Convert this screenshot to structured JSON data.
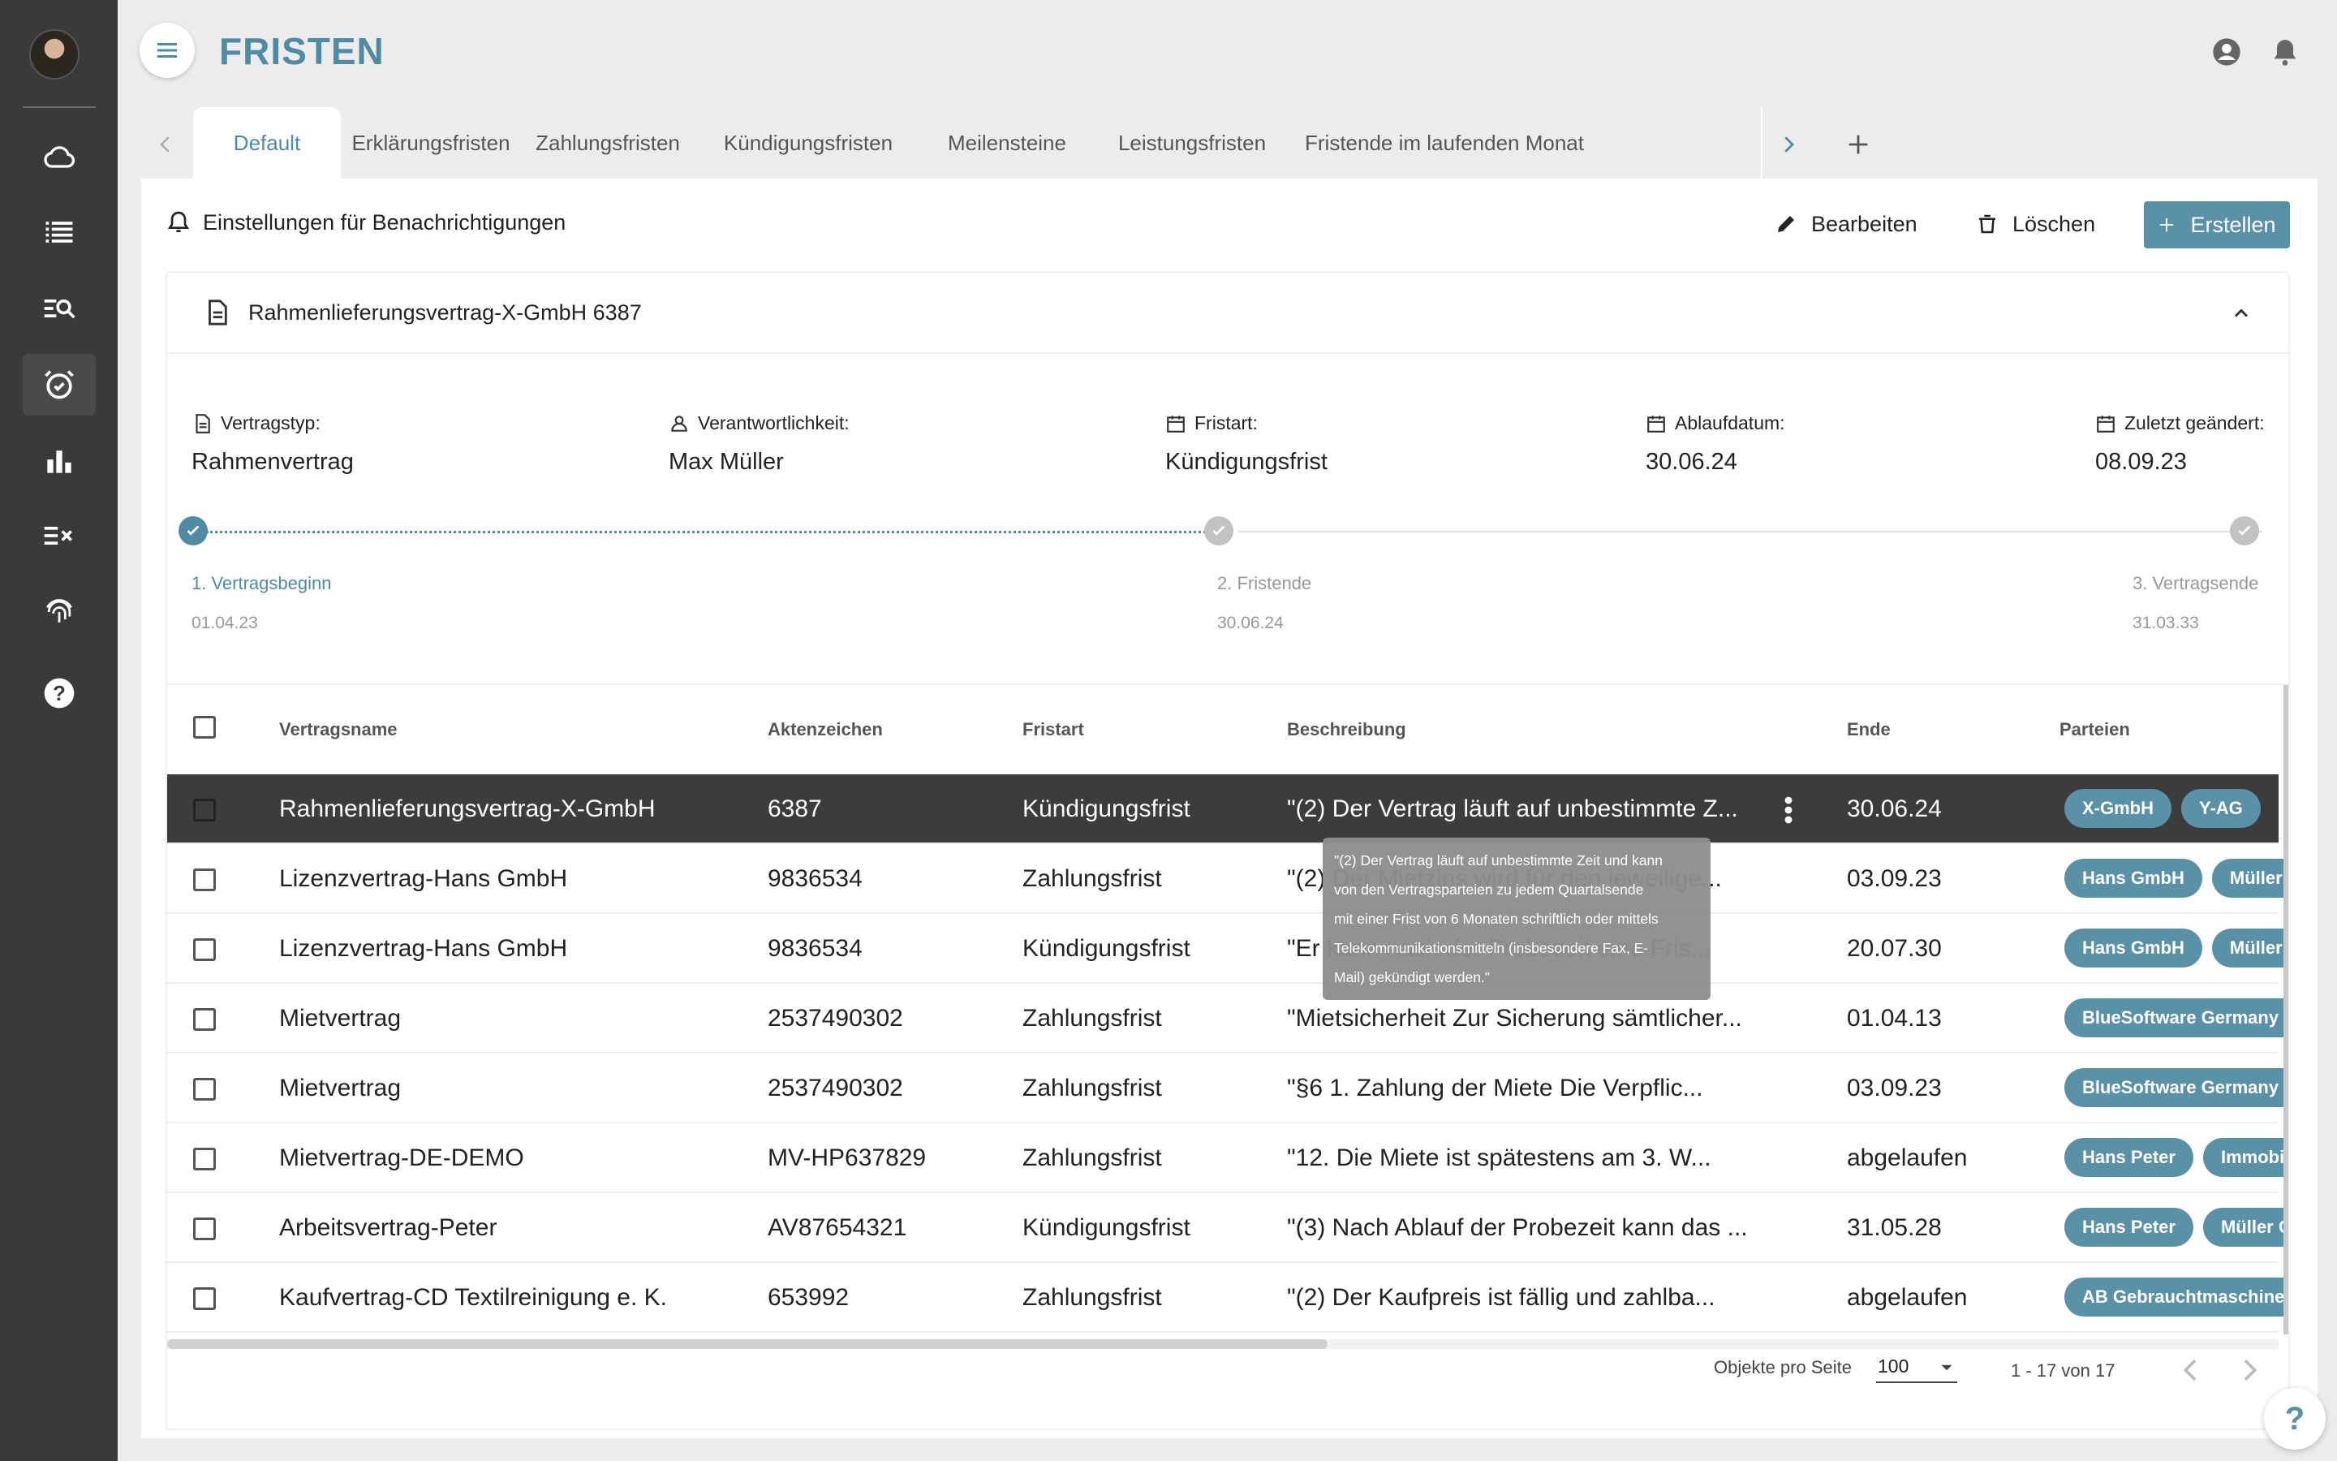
{
  "app": {
    "title": "FRISTEN"
  },
  "colors": {
    "accent": "#4f8ba3",
    "chip": "#5b91a7",
    "sidebar": "#3a3a3a",
    "selected_row": "#3c3c3c"
  },
  "sidebar": {
    "items": [
      {
        "icon": "cloud-icon"
      },
      {
        "icon": "list-icon"
      },
      {
        "icon": "search-list-icon"
      },
      {
        "icon": "alarm-clock-icon",
        "active": true
      },
      {
        "icon": "bar-chart-icon"
      },
      {
        "icon": "checklist-icon"
      },
      {
        "icon": "fingerprint-icon"
      },
      {
        "icon": "help-icon"
      }
    ]
  },
  "tabs": {
    "items": [
      {
        "label": "Default",
        "active": true
      },
      {
        "label": "Erklärungsfristen"
      },
      {
        "label": "Zahlungsfristen"
      },
      {
        "label": "Kündigungsfristen"
      },
      {
        "label": "Meilensteine"
      },
      {
        "label": "Leistungsfristen"
      },
      {
        "label": "Fristende im laufenden Monat"
      }
    ]
  },
  "toolbar": {
    "notifications_label": "Einstellungen für Benachrichtigungen",
    "edit_label": "Bearbeiten",
    "delete_label": "Löschen",
    "create_label": "Erstellen"
  },
  "detail": {
    "title": "Rahmenlieferungsvertrag-X-GmbH 6387",
    "fields": {
      "contract_type": {
        "label": "Vertragstyp:",
        "value": "Rahmenvertrag"
      },
      "responsible": {
        "label": "Verantwortlichkeit:",
        "value": "Max Müller"
      },
      "deadline_type": {
        "label": "Fristart:",
        "value": "Kündigungsfrist"
      },
      "expiry": {
        "label": "Ablaufdatum:",
        "value": "30.06.24"
      },
      "modified": {
        "label": "Zuletzt geändert:",
        "value": "08.09.23"
      }
    },
    "timeline": {
      "start": {
        "label": "1. Vertragsbeginn",
        "date": "01.04.23"
      },
      "deadline": {
        "label": "2. Fristende",
        "date": "30.06.24"
      },
      "end": {
        "label": "3. Vertragsende",
        "date": "31.03.33"
      }
    }
  },
  "table": {
    "headers": {
      "name": "Vertragsname",
      "file": "Aktenzeichen",
      "type": "Fristart",
      "desc": "Beschreibung",
      "end": "Ende",
      "parties": "Parteien"
    },
    "rows": [
      {
        "name": "Rahmenlieferungsvertrag-X-GmbH",
        "file": "6387",
        "type": "Kündigungsfrist",
        "desc": "\"(2) Der Vertrag läuft auf unbestimmte Z...",
        "end": "30.06.24",
        "parties": [
          "X-GmbH",
          "Y-AG"
        ],
        "selected": true
      },
      {
        "name": "Lizenzvertrag-Hans GmbH",
        "file": "9836534",
        "type": "Zahlungsfrist",
        "desc": "\"(2) Der Mietzins wird für den jeweilige...",
        "end": "03.09.23",
        "parties": [
          "Hans GmbH",
          "Müller G"
        ]
      },
      {
        "name": "Lizenzvertrag-Hans GmbH",
        "file": "9836534",
        "type": "Kündigungsfrist",
        "desc": "\"Er kann nach der Probezeit eine Fris...",
        "end": "20.07.30",
        "parties": [
          "Hans GmbH",
          "Müller G"
        ]
      },
      {
        "name": "Mietvertrag",
        "file": "2537490302",
        "type": "Zahlungsfrist",
        "desc": "\"Mietsicherheit Zur Sicherung sämtlicher...",
        "end": "01.04.13",
        "parties": [
          "BlueSoftware Germany G"
        ]
      },
      {
        "name": "Mietvertrag",
        "file": "2537490302",
        "type": "Zahlungsfrist",
        "desc": "\"§6 1. Zahlung der Miete Die Verpflic...",
        "end": "03.09.23",
        "parties": [
          "BlueSoftware Germany G"
        ]
      },
      {
        "name": "Mietvertrag-DE-DEMO",
        "file": "MV-HP637829",
        "type": "Zahlungsfrist",
        "desc": "\"12. Die Miete ist spätestens am 3. W...",
        "end": "abgelaufen",
        "parties": [
          "Hans Peter",
          "Immobili"
        ]
      },
      {
        "name": "Arbeitsvertrag-Peter",
        "file": "AV87654321",
        "type": "Kündigungsfrist",
        "desc": "\"(3) Nach Ablauf der Probezeit kann das ...",
        "end": "31.05.28",
        "parties": [
          "Hans Peter",
          "Müller Gi"
        ]
      },
      {
        "name": "Kaufvertrag-CD Textilreinigung e. K.",
        "file": "653992",
        "type": "Zahlungsfrist",
        "desc": "\"(2) Der Kaufpreis ist fällig und zahlba...",
        "end": "abgelaufen",
        "parties": [
          "AB Gebrauchtmaschinen"
        ]
      }
    ]
  },
  "tooltip": {
    "lines": [
      "\"(2) Der Vertrag läuft auf unbestimmte Zeit und kann",
      "von den Vertragsparteien zu jedem Quartalsende",
      "mit einer Frist von 6 Monaten schriftlich oder mittels",
      "Telekommunikationsmitteln (insbesondere Fax, E-",
      "Mail) gekündigt werden.\""
    ]
  },
  "pagination": {
    "per_page_label": "Objekte pro Seite",
    "per_page_value": "100",
    "range": "1 - 17 von 17"
  },
  "help_fab": {
    "label": "?"
  }
}
